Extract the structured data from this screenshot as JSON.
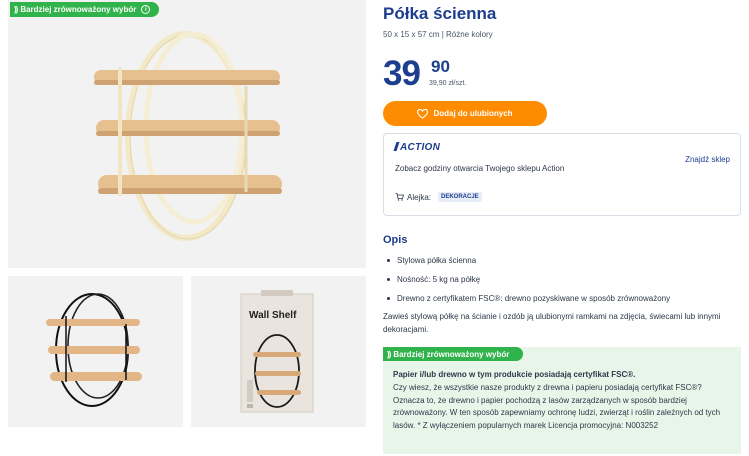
{
  "badge": {
    "label": "Bardziej zrównoważony wybór",
    "info": "i",
    "lead": "))"
  },
  "product": {
    "title": "Półka ścienna",
    "subtitle": "50 x 15 x 57 cm | Różne kolory",
    "price_main": "39",
    "price_cents": "90",
    "price_unit": "39,90 zł/szt.",
    "fav_button": "Dodaj do ulubionych"
  },
  "thumb_packaging": {
    "label": "Wall Shelf"
  },
  "store": {
    "logo": "ACTION",
    "hours_text": "Zobacz godziny otwarcia Twojego sklepu Action",
    "find_store": "Znajdź sklep",
    "aisle_label": "Alejka:",
    "aisle_value": "DEKORACJE"
  },
  "description": {
    "heading": "Opis",
    "bullets": [
      "Stylowa półka ścienna",
      "Nośność: 5 kg na półkę",
      "Drewno z certyfikatem FSC®: drewno pozyskiwane w sposób zrównoważony"
    ],
    "text": "Zawieś stylową półkę na ścianie i ozdób ją ulubionymi ramkami na zdjęcia, świecami lub innymi dekoracjami."
  },
  "eco_info": {
    "heading": "Bardziej zrównoważony wybór",
    "bold": "Papier i/lub drewno w tym produkcie posiadają certyfikat FSC®.",
    "text": "Czy wiesz, że wszystkie nasze produkty z drewna i papieru posiadają certyfikat FSC®? Oznacza to, że drewno i papier pochodzą z lasów zarządzanych w sposób bardziej zrównoważony. W ten sposób zapewniamy ochronę ludzi, zwierząt i roślin zależnych od tych lasów. * Z wyłączeniem popularnych marek Licencja promocyjna: N003252"
  },
  "colors": {
    "brand_blue": "#1d3e8f",
    "orange": "#ff8c00",
    "eco_green": "#2fb34a",
    "eco_bg": "#e8f6ea",
    "wood": "#e3b98a",
    "frame_cream": "#f3e9c8"
  }
}
